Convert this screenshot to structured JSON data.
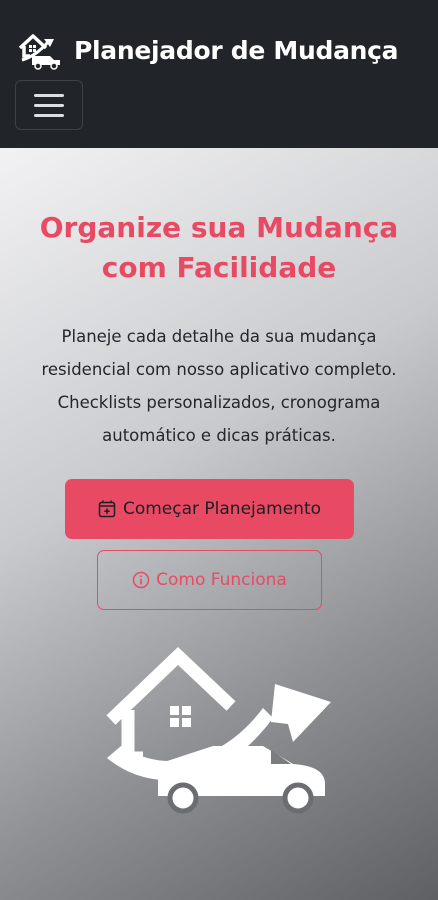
{
  "navbar": {
    "brand_title": "Planejador de Mudança",
    "brand_icon": "moving-truck-house-icon",
    "menu_icon": "hamburger-menu-icon"
  },
  "hero": {
    "title": "Organize sua Mudança com Facilidade",
    "description": "Planeje cada detalhe da sua mudança residencial com nosso aplicativo completo. Checklists personalizados, cronograma automático e dicas práticas.",
    "primary_button": {
      "label": "Começar Planejamento",
      "icon": "calendar-plus-icon"
    },
    "secondary_button": {
      "label": "Como Funciona",
      "icon": "info-circle-icon"
    },
    "illustration": "house-truck-arrow-illustration"
  },
  "colors": {
    "navbar_bg": "#212529",
    "accent": "#e84a64",
    "text_dark": "#23272b",
    "white": "#ffffff"
  }
}
